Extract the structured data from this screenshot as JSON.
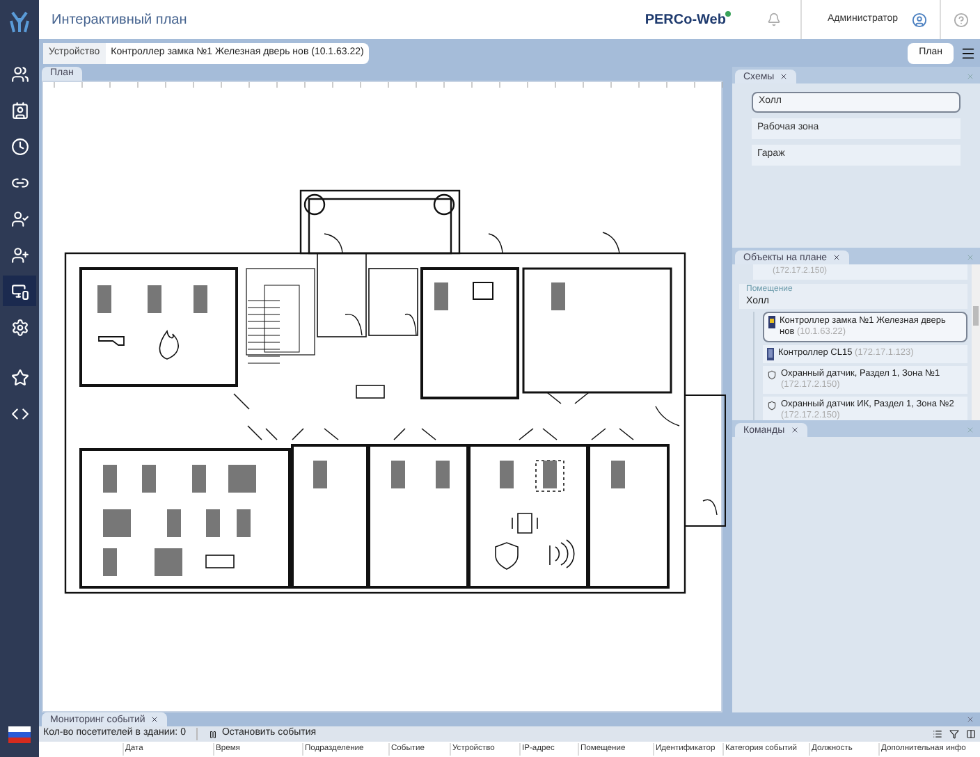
{
  "app": {
    "title": "Интерактивный план",
    "brand": "PERCo-Web",
    "user": "Администратор"
  },
  "sidebar": {
    "items": [
      {
        "kind": "users",
        "selected": false
      },
      {
        "kind": "badge",
        "selected": false
      },
      {
        "kind": "clock",
        "selected": false
      },
      {
        "kind": "pass",
        "selected": false
      },
      {
        "kind": "check",
        "selected": false
      },
      {
        "kind": "add",
        "selected": false
      },
      {
        "kind": "monitor",
        "selected": true
      },
      {
        "kind": "gear",
        "selected": false
      },
      {
        "kind": "star",
        "selected": false
      },
      {
        "kind": "code",
        "selected": false
      }
    ]
  },
  "toolbar": {
    "device_label": "Устройство",
    "device_value": "Контроллер замка №1 Железная дверь нов (10.1.63.22)",
    "plan_button": "План"
  },
  "plan_panel": {
    "tab": "План"
  },
  "schemes_panel": {
    "tab": "Схемы",
    "items": [
      {
        "label": "Холл",
        "selected": true
      },
      {
        "label": "Рабочая зона",
        "selected": false
      },
      {
        "label": "Гараж",
        "selected": false
      }
    ]
  },
  "objects_panel": {
    "tab": "Объекты на плане",
    "cut_item_ip": "(172.17.2.150)",
    "group_label": "Помещение",
    "group_name": "Холл",
    "items": [
      {
        "kind": "lock_controller",
        "name": "Контроллер замка №1 Железная дверь нов",
        "ip": "(10.1.63.22)",
        "selected": true
      },
      {
        "kind": "controller",
        "name": "Контроллер CL15",
        "ip": "(172.17.1.123)",
        "selected": false
      },
      {
        "kind": "sensor",
        "name": "Охранный датчик, Раздел 1, Зона №1",
        "ip": "(172.17.2.150)",
        "selected": false
      },
      {
        "kind": "sensor",
        "name": "Охранный датчик ИК, Раздел 1, Зона №2",
        "ip": "(172.17.2.150)",
        "selected": false
      }
    ]
  },
  "commands_panel": {
    "tab": "Команды"
  },
  "events_panel": {
    "tab": "Мониторинг событий",
    "visitors": "Кол-во посетителей в здании: 0",
    "stop_button": "Остановить события",
    "columns": [
      "Дата",
      "Время",
      "Подразделение",
      "Событие",
      "Устройство",
      "IP-адрес",
      "Помещение",
      "Идентификатор",
      "Категория событий",
      "Должность",
      "Дополнительная инфо"
    ]
  }
}
